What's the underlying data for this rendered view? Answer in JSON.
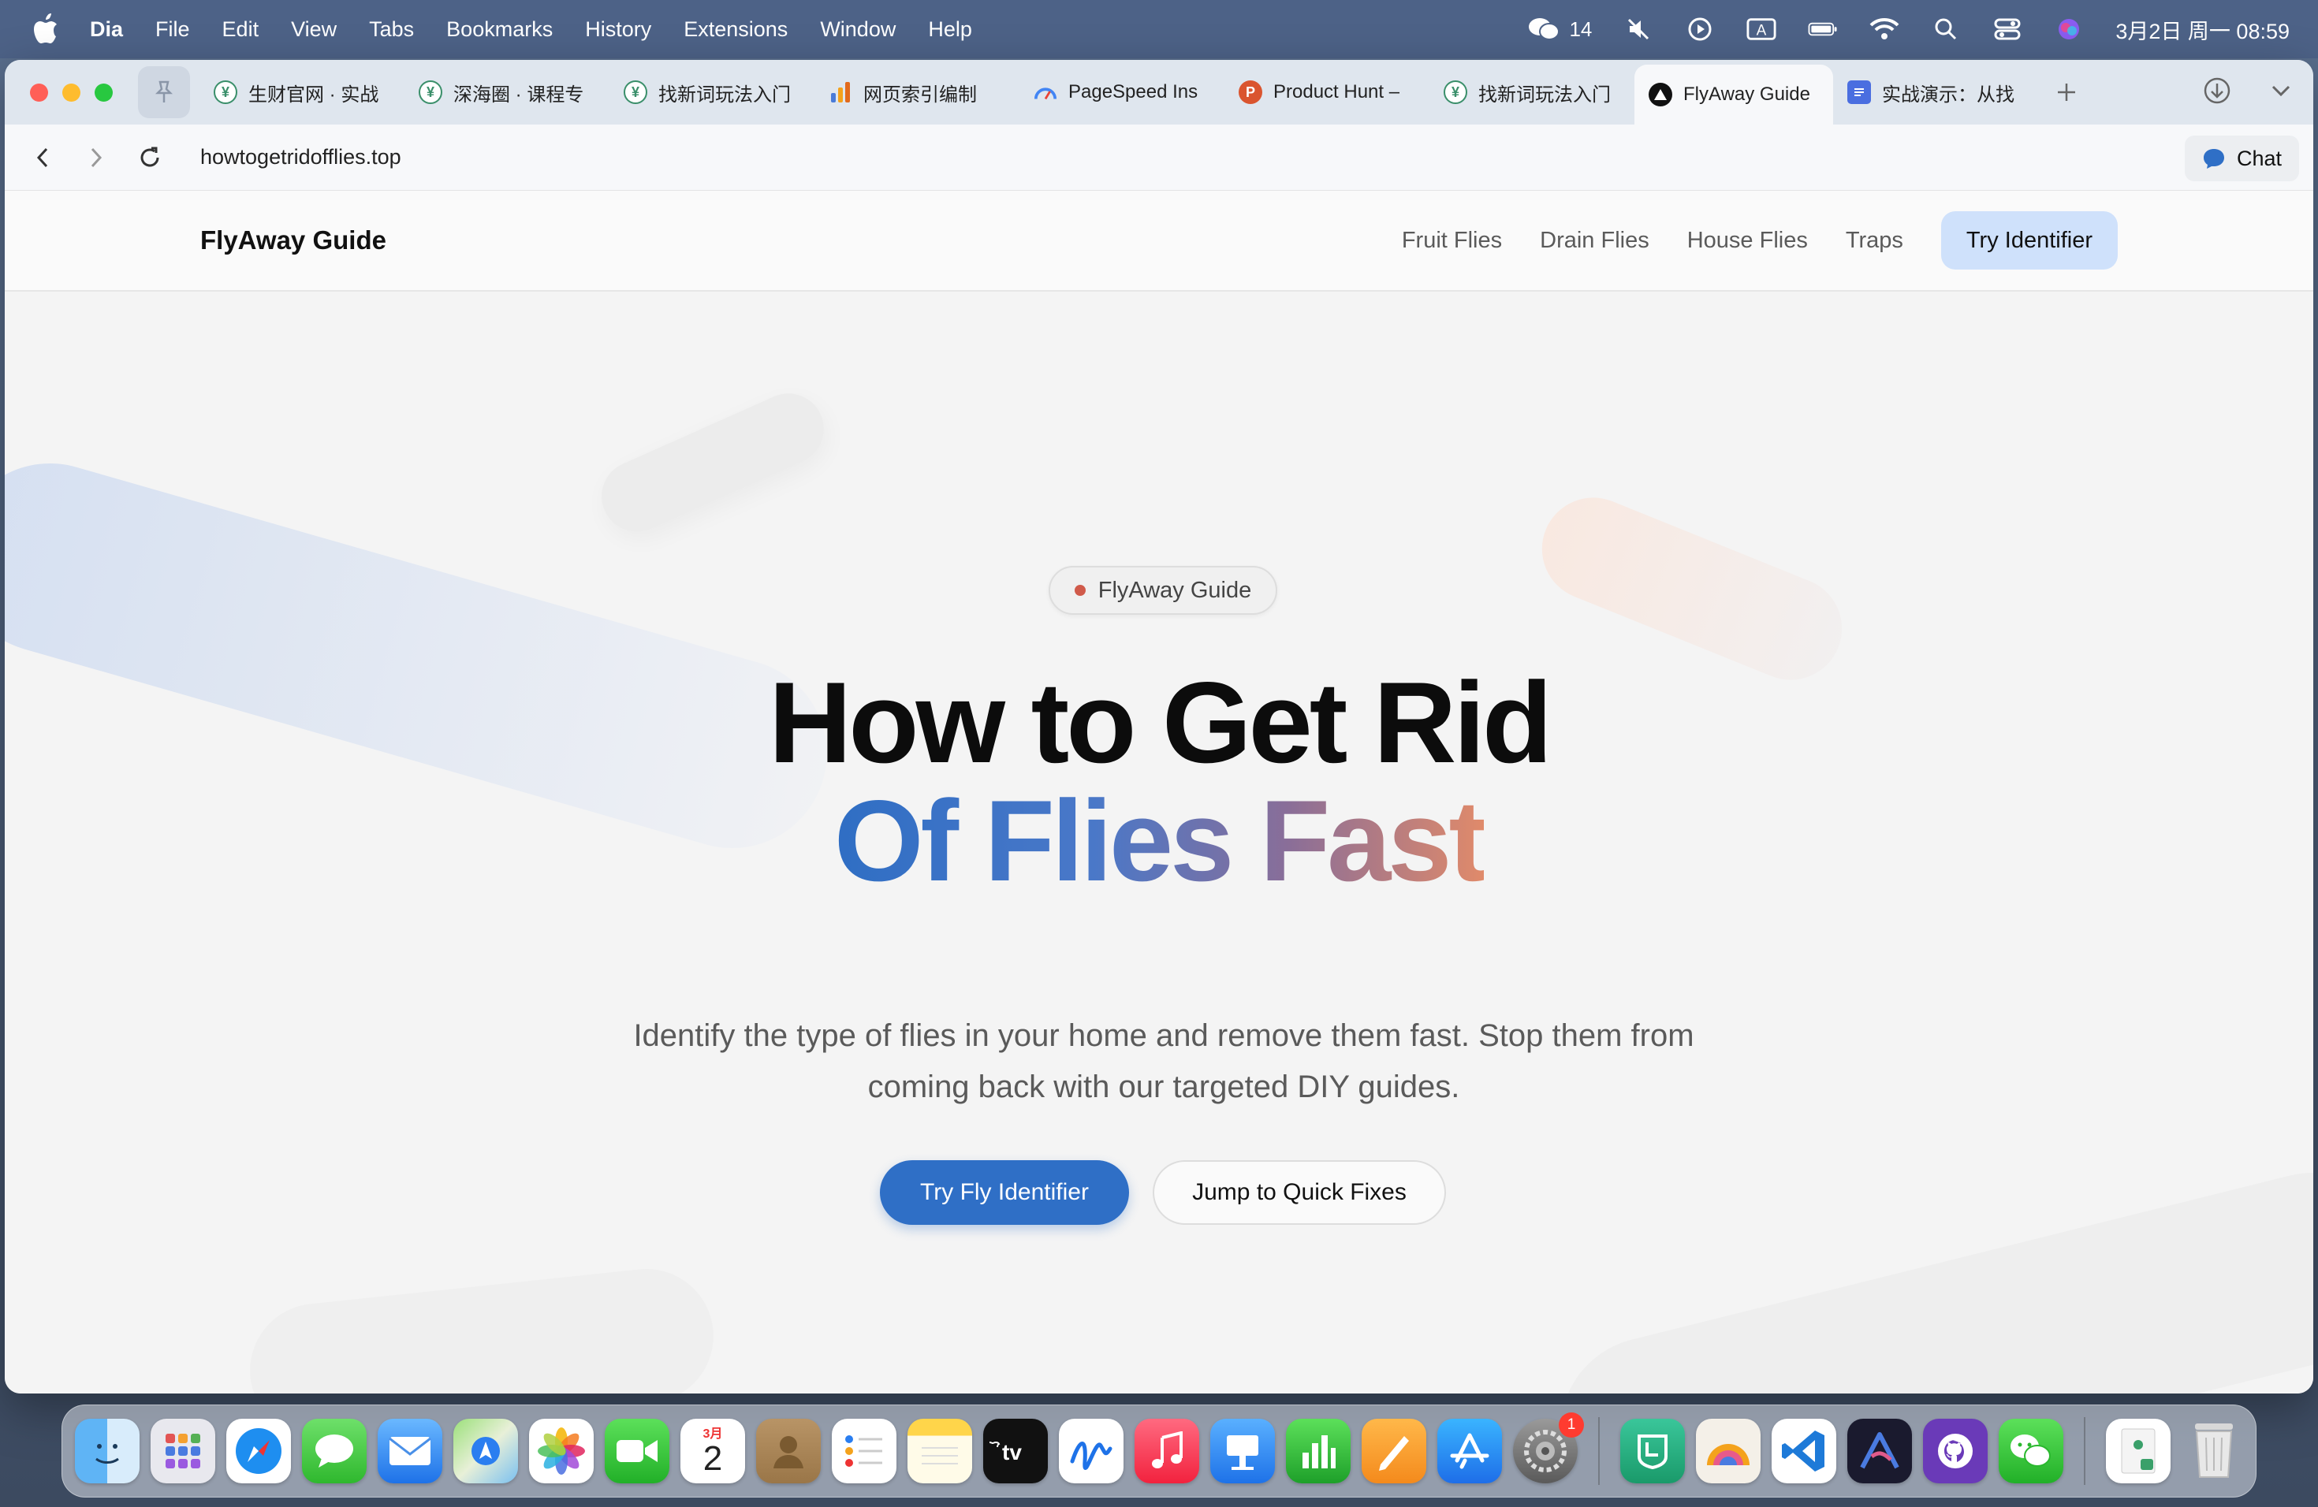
{
  "menubar": {
    "app_name": "Dia",
    "items": [
      "File",
      "Edit",
      "View",
      "Tabs",
      "Bookmarks",
      "History",
      "Extensions",
      "Window",
      "Help"
    ],
    "wechat_count": "14",
    "datetime": "3月2日 周一 08:59"
  },
  "tabs": [
    {
      "label": "生财官网 · 实战",
      "icon": "coin-icon",
      "color": "#3a8f6a"
    },
    {
      "label": "深海圈 · 课程专",
      "icon": "coin-icon",
      "color": "#3a8f6a"
    },
    {
      "label": "找新词玩法入门",
      "icon": "coin-icon",
      "color": "#3a8f6a"
    },
    {
      "label": "网页索引编制",
      "icon": "analytics-icon",
      "color": "#f4a21c"
    },
    {
      "label": "PageSpeed Ins",
      "icon": "pagespeed-icon",
      "color": "#4285f4"
    },
    {
      "label": "Product Hunt –",
      "icon": "producthunt-icon",
      "color": "#da552f"
    },
    {
      "label": "找新词玩法入门",
      "icon": "coin-icon",
      "color": "#3a8f6a"
    },
    {
      "label": "FlyAway Guide",
      "icon": "flyaway-icon",
      "color": "#111111",
      "active": true
    },
    {
      "label": "实战演示：从找",
      "icon": "docs-icon",
      "color": "#4a6ee0"
    }
  ],
  "address": {
    "url": "howtogetridofflies.top",
    "chat_label": "Chat"
  },
  "site": {
    "brand": "FlyAway Guide",
    "nav": [
      "Fruit Flies",
      "Drain Flies",
      "House Flies",
      "Traps"
    ],
    "nav_cta": "Try Identifier"
  },
  "hero": {
    "badge": "FlyAway Guide",
    "title_line1": "How to Get Rid",
    "title_line2": "Of Flies Fast",
    "subtitle": "Identify the type of flies in your home and remove them fast. Stop them from coming back with our targeted DIY guides.",
    "primary_cta": "Try Fly Identifier",
    "secondary_cta": "Jump to Quick Fixes"
  },
  "dock": {
    "calendar_month": "3月",
    "calendar_day": "2",
    "settings_badge": "1",
    "apps": [
      "finder-icon",
      "launchpad-icon",
      "safari-icon",
      "messages-icon",
      "mail-icon",
      "maps-icon",
      "photos-icon",
      "facetime-icon",
      "calendar-icon",
      "contacts-icon",
      "reminders-icon",
      "notes-icon",
      "appletv-icon",
      "freeform-icon",
      "music-icon",
      "keynote-icon",
      "numbers-icon",
      "pages-icon",
      "appstore-icon",
      "settings-icon",
      "app-icon",
      "app-icon",
      "vscode-icon",
      "app-icon",
      "github-icon",
      "wechat-icon",
      "preview-icon",
      "trash-icon"
    ]
  },
  "colors": {
    "accent": "#2f6fc6",
    "cta_bg": "#cfe1fb",
    "gradient": [
      "#2f6ec4",
      "#8a6e98",
      "#e08a6a"
    ]
  }
}
